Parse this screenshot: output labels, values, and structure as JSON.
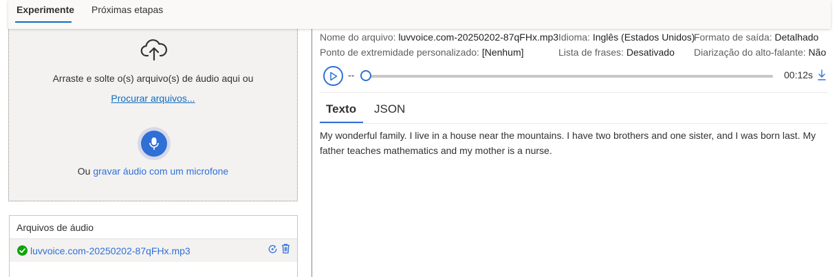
{
  "tabs": {
    "experiment": "Experimente",
    "next_steps": "Próximas etapas"
  },
  "dropzone": {
    "drag_text": "Arraste e solte o(s) arquivo(s) de áudio aqui ou",
    "browse_link": "Procurar arquivos...",
    "record_prefix": "Ou",
    "record_link": "gravar áudio com um microfone"
  },
  "files": {
    "title": "Arquivos de áudio",
    "items": [
      {
        "name": "luvvoice.com-20250202-87qFHx.mp3",
        "status": "success"
      }
    ]
  },
  "details": {
    "file_name_label": "Nome do arquivo:",
    "file_name_value": "luvvoice.com-20250202-87qFHx.mp3",
    "language_label": "Idioma:",
    "language_value": "Inglês (Estados Unidos)",
    "output_format_label": "Formato de saída:",
    "output_format_value": "Detalhado",
    "endpoint_label": "Ponto de extremidade personalizado:",
    "endpoint_value": "[Nenhum]",
    "phrase_list_label": "Lista de frases:",
    "phrase_list_value": "Desativado",
    "diarization_label": "Diarização do alto-falante:",
    "diarization_value": "Não"
  },
  "player": {
    "current_time": "--",
    "duration": "00:12s",
    "progress": 0
  },
  "result_tabs": {
    "text": "Texto",
    "json": "JSON"
  },
  "transcript": "My wonderful family. I live in a house near the mountains. I have two brothers and one sister, and I was born last. My father teaches mathematics and my mother is a nurse.",
  "colors": {
    "accent": "#2f6fd6",
    "tab_underline": "#0f6cbd",
    "success": "#13a10e",
    "panel_bg": "#f3f2f1"
  },
  "icons": {
    "upload": "cloud-upload-icon",
    "mic": "microphone-icon",
    "success": "check-circle-icon",
    "reprocess": "reprocess-icon",
    "delete": "trash-icon",
    "play": "play-icon",
    "download": "download-icon"
  }
}
